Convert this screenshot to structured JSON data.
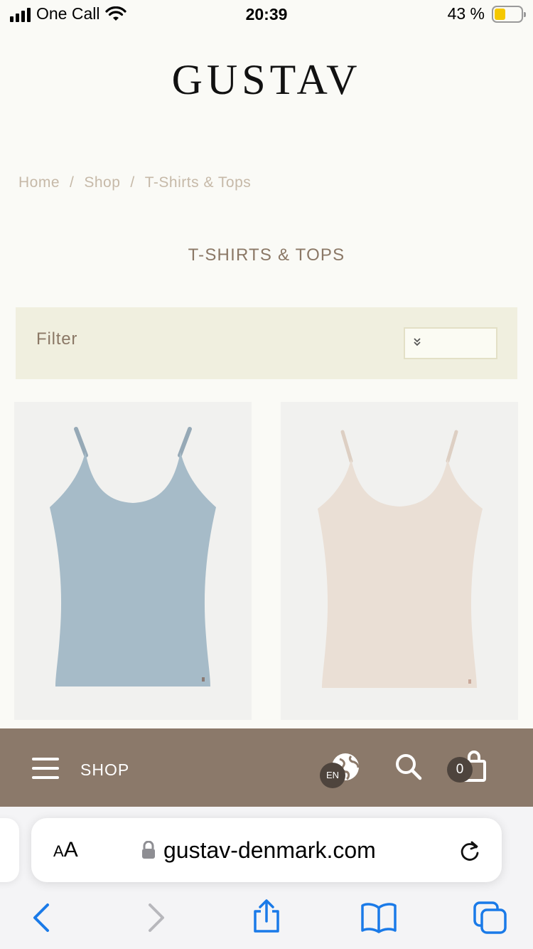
{
  "status_bar": {
    "carrier": "One Call",
    "time": "20:39",
    "battery_percent": "43 %",
    "battery_level": 0.43,
    "battery_color": "#f5c800"
  },
  "site": {
    "logo": "GUSTAV"
  },
  "breadcrumb": {
    "items": [
      "Home",
      "Shop",
      "T-Shirts & Tops"
    ],
    "separator": "/"
  },
  "page_title": "T-SHIRTS & TOPS",
  "filter": {
    "label": "Filter",
    "sort_value": ""
  },
  "products": [
    {
      "color": "#a6bbc8",
      "color_name": "light blue"
    },
    {
      "color": "#eadfd5",
      "color_name": "beige"
    }
  ],
  "site_nav": {
    "menu_label": "SHOP",
    "language": "EN",
    "cart_count": "0",
    "background": "#8b796a"
  },
  "browser": {
    "text_size_label": "AA",
    "url": "gustav-denmark.com",
    "accent": "#1a7ae8"
  },
  "icons": [
    "menu-icon",
    "globe-icon",
    "search-icon",
    "bag-icon",
    "lock-icon",
    "reload-icon",
    "back-icon",
    "forward-icon",
    "share-icon",
    "bookmarks-icon",
    "tabs-icon"
  ]
}
